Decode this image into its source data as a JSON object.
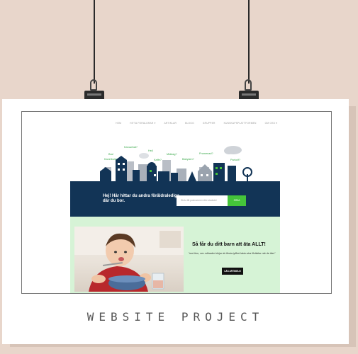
{
  "poster": {
    "caption": "WEBSITE PROJECT"
  },
  "site": {
    "nav": {
      "items": [
        "HEM",
        "HITTA FÖRÄLDRAR ▾",
        "ARTIKLAR",
        "BLOGG",
        "GRUPPER",
        "KUNSKAPSPLATTFORMEN",
        "OM OSS ▾"
      ]
    },
    "hero": {
      "bubbles": [
        "Kanuwhat?",
        "Hej!",
        "Bra!",
        "Middag?",
        "Kanelbullar?",
        "Kaffe?",
        "Promenad?",
        "Parkolf?",
        "Babysim?"
      ]
    },
    "banner": {
      "text": "Hej! Här hittar du andra föräldralediga där du bor.",
      "search_placeholder": "Skriv ditt postnummer eller stadsdel",
      "search_button": "SÖKA"
    },
    "feature": {
      "title": "Så får du ditt barn att äta ALLT!",
      "quote": "\"runt fem, sex månader börjar de flesta tyfiket lakta sina föräldrar när de äter\"",
      "button": "LÄS ARTIKELN"
    }
  },
  "colors": {
    "wall": "#e8d6cb",
    "banner": "#123456",
    "accent_green": "#45c43a",
    "feature_bg": "#d6f3d6"
  }
}
